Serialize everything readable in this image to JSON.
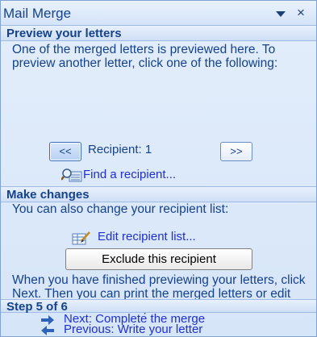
{
  "pane": {
    "title": "Mail Merge",
    "close_glyph": "×"
  },
  "preview": {
    "heading": "Preview your letters",
    "description": "One of the merged letters is previewed here. To preview another letter, click one of the following:",
    "prev_label": "<<",
    "next_label": ">>",
    "recipient_label": "Recipient: 1",
    "find_link": "Find a recipient..."
  },
  "changes": {
    "heading": "Make changes",
    "description": "You can also change your recipient list:",
    "edit_link": "Edit recipient list...",
    "exclude_label": "Exclude this recipient",
    "finish_text": "When you have finished previewing your letters, click Next. Then you can print the merged letters or edit individual letters to add personal comments."
  },
  "step": {
    "heading": "Step 5 of 6",
    "next_link": "Next: Complete the merge",
    "previous_link": "Previous: Write your letter"
  },
  "icons": [
    "dropdown-arrow-icon",
    "close-icon",
    "find-recipient-icon",
    "edit-list-icon",
    "next-arrow-icon",
    "previous-arrow-icon"
  ],
  "colors": {
    "heading": "#15428b",
    "link": "#1f2fd3",
    "background": "#dce9f9"
  }
}
